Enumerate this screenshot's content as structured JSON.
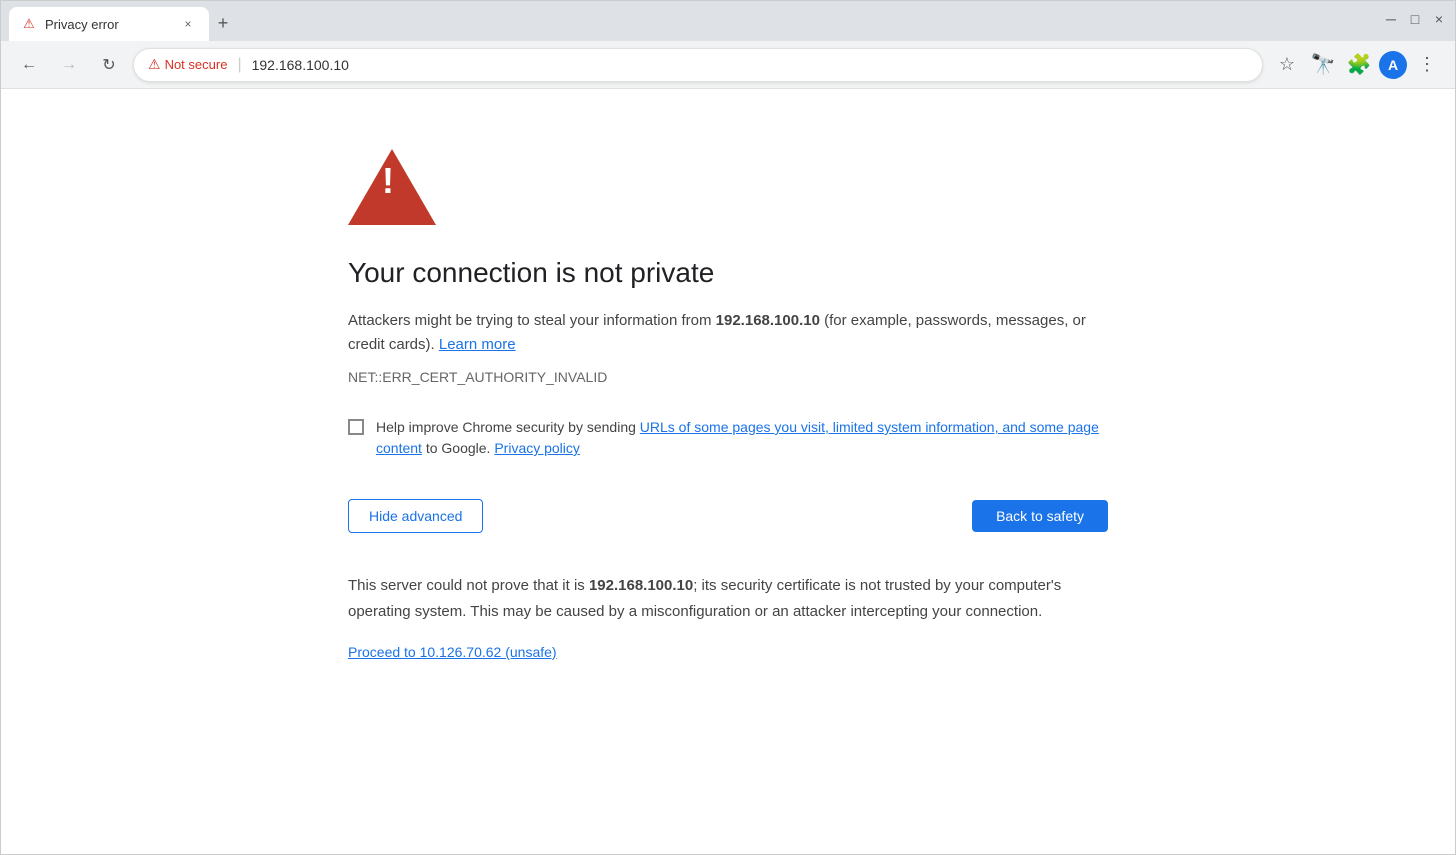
{
  "browser": {
    "tab": {
      "favicon": "⚠",
      "title": "Privacy error",
      "close_icon": "×"
    },
    "new_tab_icon": "+",
    "window_controls": {
      "minimize": "─",
      "maximize": "□",
      "close": "×"
    },
    "nav": {
      "back_icon": "←",
      "forward_icon": "→",
      "reload_icon": "↻",
      "not_secure_label": "Not secure",
      "address_separator": "|",
      "url": "192.168.100.10",
      "star_icon": "☆",
      "more_icon": "⋮",
      "profile_letter": "A"
    }
  },
  "page": {
    "title": "Your connection is not private",
    "description_before": "Attackers might be trying to steal your information from ",
    "host": "192.168.100.10",
    "description_middle": " (for example, passwords, messages, or credit cards). ",
    "learn_more": "Learn more",
    "error_code": "NET::ERR_CERT_AUTHORITY_INVALID",
    "checkbox": {
      "label_before": "Help improve Chrome security by sending ",
      "link_text": "URLs of some pages you visit, limited system information, and some page content",
      "label_middle": " to Google. ",
      "privacy_link": "Privacy policy"
    },
    "buttons": {
      "hide_advanced": "Hide advanced",
      "back_to_safety": "Back to safety"
    },
    "advanced_text_before": "This server could not prove that it is ",
    "advanced_host": "192.168.100.10",
    "advanced_text_after": "; its security certificate is not trusted by your computer's operating system. This may be caused by a misconfiguration or an attacker intercepting your connection.",
    "proceed_link": "Proceed to 10.126.70.62 (unsafe)"
  }
}
